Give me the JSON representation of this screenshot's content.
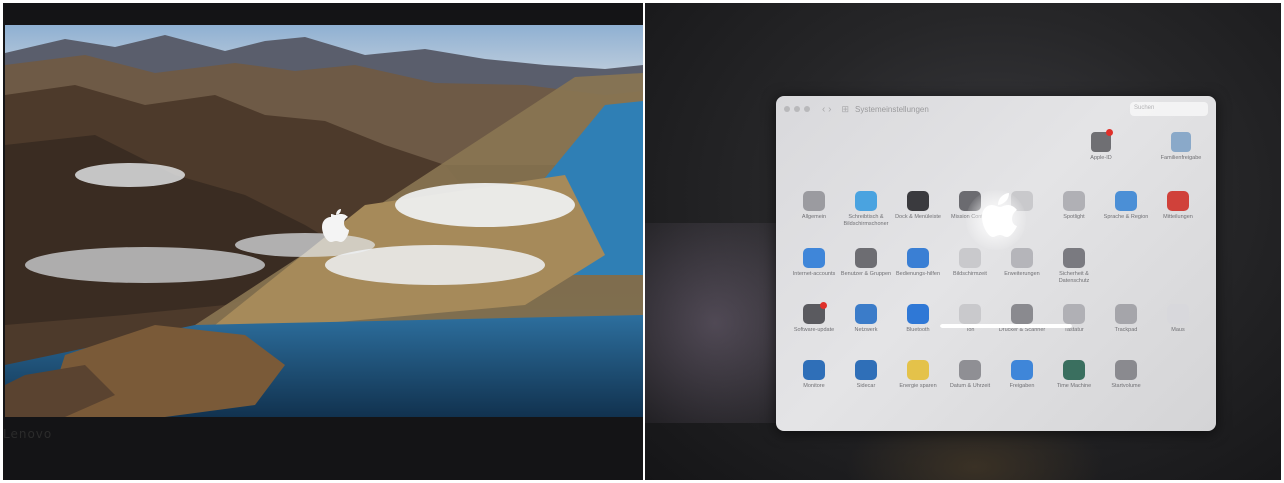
{
  "left_photo": {
    "bezel_brand": "Lenovo",
    "dock_icon_colors": [
      "#3b82d6",
      "#9aa4b4",
      "#5ab0f0",
      "#3aa0e8",
      "#e84c3d",
      "#f5a623",
      "#e9e9e9",
      "#f2c94c",
      "#f06292",
      "#5ac85a",
      "#e74c3c",
      "#c0c0c0",
      "#4a90d9",
      "#34c759",
      "#a0a0a0",
      "#1c1c1e",
      "#6fc36f",
      "#30d158",
      "#ff3b30",
      "#ff9f0a",
      "#0a84ff",
      "#34c759",
      "#5e5ce6",
      "#ff375f",
      "#0a84ff",
      "#8e8e93",
      "#2c2c2e",
      "#ff453a",
      "#64d2ff",
      "#bf5af2",
      "#ffd60a",
      "#0a84ff",
      "#e5e5ea",
      "#8e8e93",
      "#c7c7cc"
    ]
  },
  "right_photo": {
    "window": {
      "title": "Systemeinstellungen",
      "search_placeholder": "Suchen",
      "accounts": [
        {
          "label": "Apple-ID",
          "icon": "apple-id-icon",
          "color": "#6f6f73",
          "badge": true
        },
        {
          "label": "Familienfreigabe",
          "icon": "family-sharing-icon",
          "color": "#8aa9c9",
          "badge": false
        }
      ],
      "rows": [
        [
          {
            "label": "Allgemein",
            "icon": "general-icon",
            "color": "#9b9ba0"
          },
          {
            "label": "Schreibtisch & Bildschirmschoner",
            "icon": "desktop-icon",
            "color": "#4aa3e0"
          },
          {
            "label": "Dock & Menüleiste",
            "icon": "dock-icon",
            "color": "#3a3a3e"
          },
          {
            "label": "Mission Control",
            "icon": "mission-control-icon",
            "color": "#6b6b70"
          },
          {
            "label": "",
            "icon": "siri-icon",
            "color": "#c9c9cc"
          },
          {
            "label": "Spotlight",
            "icon": "spotlight-icon",
            "color": "#b0b0b5"
          },
          {
            "label": "Sprache & Region",
            "icon": "language-region-icon",
            "color": "#4b8fd6"
          },
          {
            "label": "Mitteilungen",
            "icon": "notifications-icon",
            "color": "#d0413a"
          }
        ],
        [
          {
            "label": "Internet-accounts",
            "icon": "internet-accounts-icon",
            "color": "#3f86d9"
          },
          {
            "label": "Benutzer & Gruppen",
            "icon": "users-groups-icon",
            "color": "#6d6d72"
          },
          {
            "label": "Bedienungs-hilfen",
            "icon": "accessibility-icon",
            "color": "#3a7fd4"
          },
          {
            "label": "Bildschirmzeit",
            "icon": "screen-time-icon",
            "color": "#c9c9cc"
          },
          {
            "label": "Erweiterungen",
            "icon": "extensions-icon",
            "color": "#b5b5ba"
          },
          {
            "label": "Sicherheit & Datenschutz",
            "icon": "security-icon",
            "color": "#7a7a80"
          }
        ],
        [
          {
            "label": "Software-update",
            "icon": "software-update-icon",
            "color": "#5a5a5f",
            "badge": true
          },
          {
            "label": "Netzwerk",
            "icon": "network-icon",
            "color": "#3b7cc9"
          },
          {
            "label": "Bluetooth",
            "icon": "bluetooth-icon",
            "color": "#2f78d6"
          },
          {
            "label": "Ton",
            "icon": "sound-icon",
            "color": "#c9c9cc"
          },
          {
            "label": "Drucker & Scanner",
            "icon": "printers-icon",
            "color": "#8a8a8f"
          },
          {
            "label": "Tastatur",
            "icon": "keyboard-icon",
            "color": "#b0b0b5"
          },
          {
            "label": "Trackpad",
            "icon": "trackpad-icon",
            "color": "#a5a5aa"
          },
          {
            "label": "Maus",
            "icon": "mouse-icon",
            "color": "#d8d8dc"
          }
        ],
        [
          {
            "label": "Monitore",
            "icon": "displays-icon",
            "color": "#2f6fb8"
          },
          {
            "label": "Sidecar",
            "icon": "sidecar-icon",
            "color": "#2f6fb8"
          },
          {
            "label": "Energie sparen",
            "icon": "energy-saver-icon",
            "color": "#e4c24a"
          },
          {
            "label": "Datum & Uhrzeit",
            "icon": "date-time-icon",
            "color": "#8f8f94"
          },
          {
            "label": "Freigaben",
            "icon": "sharing-icon",
            "color": "#3f86d9"
          },
          {
            "label": "Time Machine",
            "icon": "time-machine-icon",
            "color": "#3a6f5f"
          },
          {
            "label": "Startvolume",
            "icon": "startup-disk-icon",
            "color": "#8a8a8f"
          }
        ]
      ],
      "boot_progress_percent": 100
    }
  }
}
